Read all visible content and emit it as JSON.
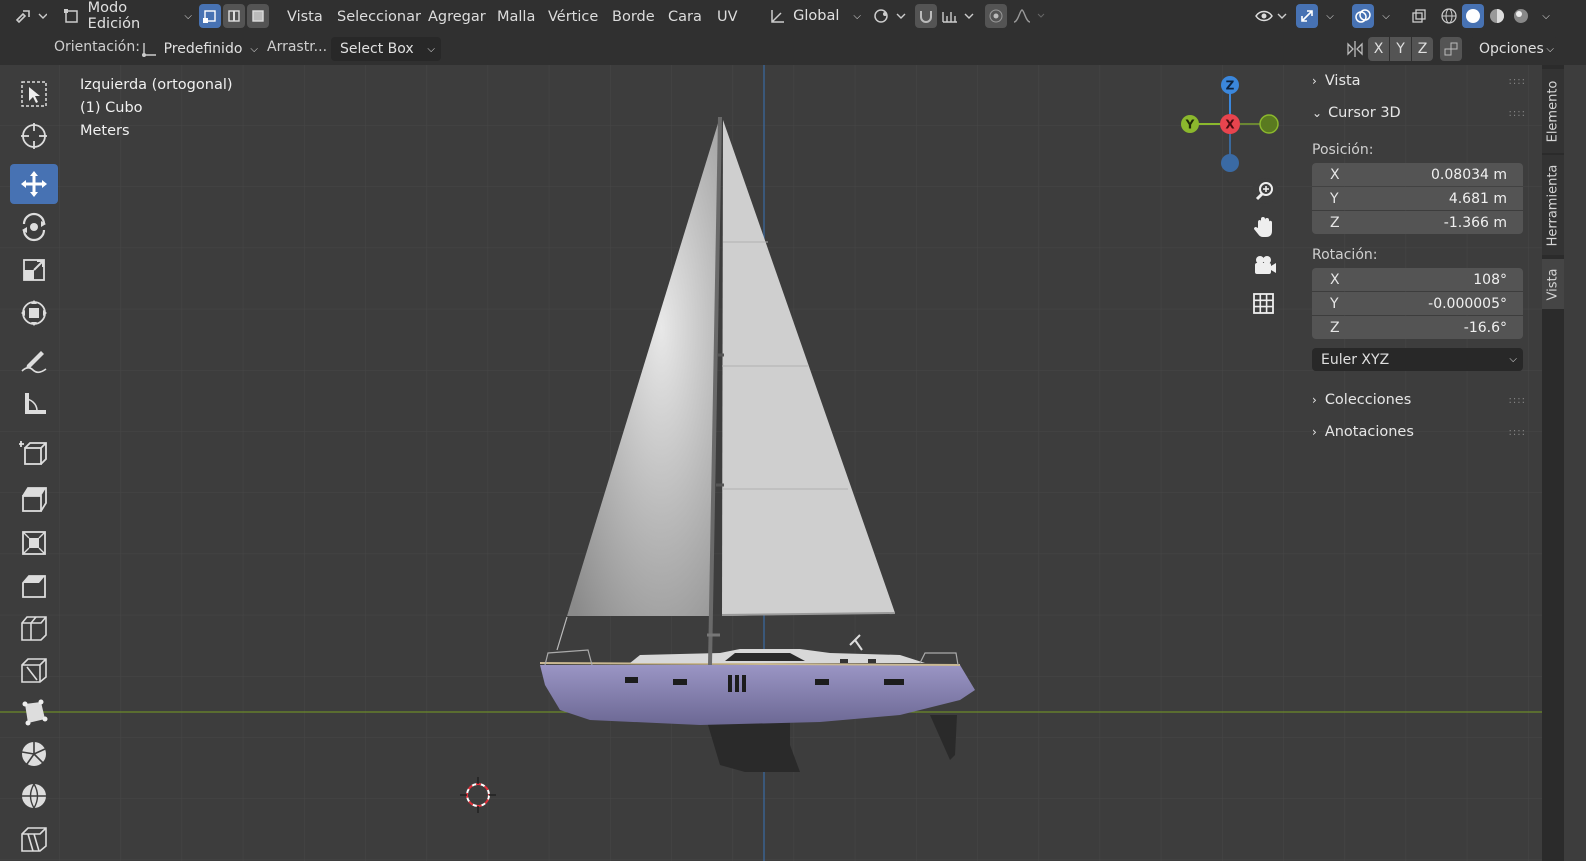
{
  "header": {
    "mode_label": "Modo Edición",
    "menus": [
      "Vista",
      "Seleccionar",
      "Agregar",
      "Malla",
      "Vértice",
      "Borde",
      "Cara",
      "UV"
    ],
    "transform_orientation": "Global"
  },
  "tool_header": {
    "orientation_label": "Orientación:",
    "orientation_value": "Predefinido",
    "drag_label": "Arrastr...",
    "drag_value": "Select Box",
    "axis_x": "X",
    "axis_y": "Y",
    "axis_z": "Z",
    "options_label": "Opciones"
  },
  "viewport": {
    "view_name": "Izquierda (ortogonal)",
    "object_name": "(1) Cubo",
    "units": "Meters",
    "gizmo": {
      "z": "Z",
      "y": "Y",
      "x": "X"
    }
  },
  "toolbar": {
    "tools": [
      "select-box",
      "cursor",
      "move",
      "rotate",
      "scale",
      "transform",
      "annotate",
      "measure",
      "add-cube",
      "extrude-region",
      "inset-faces",
      "bevel",
      "loop-cut",
      "knife",
      "poly-build",
      "spin",
      "smooth",
      "shear"
    ],
    "active_tool": "move"
  },
  "npanel": {
    "sections": {
      "vista": "Vista",
      "cursor3d": "Cursor 3D",
      "colecciones": "Colecciones",
      "anotaciones": "Anotaciones"
    },
    "location_label": "Posición:",
    "location": [
      {
        "axis": "X",
        "value": "0.08034 m"
      },
      {
        "axis": "Y",
        "value": "4.681 m"
      },
      {
        "axis": "Z",
        "value": "-1.366 m"
      }
    ],
    "rotation_label": "Rotación:",
    "rotation": [
      {
        "axis": "X",
        "value": "108°"
      },
      {
        "axis": "Y",
        "value": "-0.000005°"
      },
      {
        "axis": "Z",
        "value": "-16.6°"
      }
    ],
    "rotation_mode": "Euler XYZ"
  },
  "side_tabs": [
    "Elemento",
    "Herramienta",
    "Vista"
  ],
  "colors": {
    "accent": "#4772b3",
    "axis_x": "#e8444e",
    "axis_y": "#8bb82d",
    "axis_z": "#3b87dc",
    "hull": "#8c87b4"
  }
}
